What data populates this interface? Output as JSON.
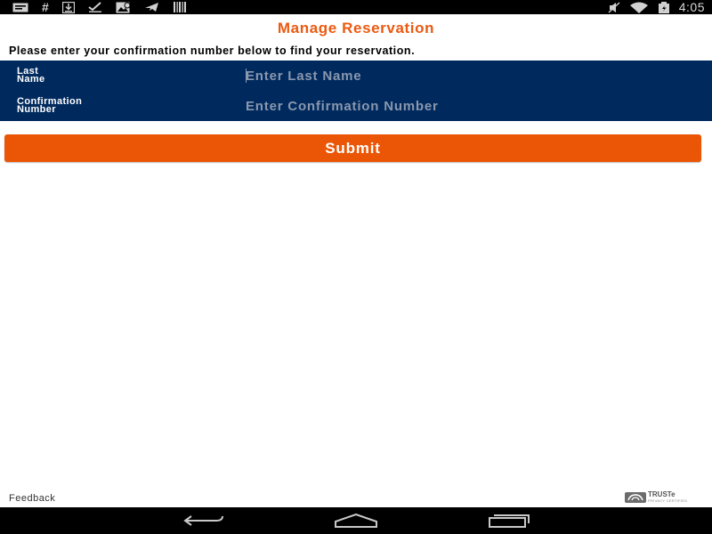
{
  "status_bar": {
    "left_icons": [
      "message-icon",
      "hash-icon",
      "download-icon",
      "check-icon",
      "gallery-icon",
      "airplane-icon",
      "barcode-icon"
    ],
    "hash_glyph": "#",
    "right_icons": [
      "mute-icon",
      "wifi-icon",
      "battery-icon"
    ],
    "time": "4:05"
  },
  "header": {
    "title": "Manage Reservation",
    "instructions": "Please enter your confirmation number below to find your reservation."
  },
  "form": {
    "last_name": {
      "label": "Last\nName",
      "placeholder": "Enter Last Name",
      "value": ""
    },
    "confirmation_number": {
      "label": "Confirmation\nNumber",
      "placeholder": "Enter Confirmation Number",
      "value": ""
    },
    "submit_label": "Submit"
  },
  "footer": {
    "feedback_label": "Feedback",
    "truste_label": "TRUSTe",
    "truste_sub": "PRIVACY CERTIFIED"
  },
  "nav_bar": {
    "buttons": [
      "back-icon",
      "home-icon",
      "recent-apps-icon"
    ]
  },
  "colors": {
    "accent_orange": "#ea5606",
    "title_orange": "#ea5a12",
    "panel_navy": "#002a5e",
    "placeholder_gray": "#8a97ad"
  }
}
